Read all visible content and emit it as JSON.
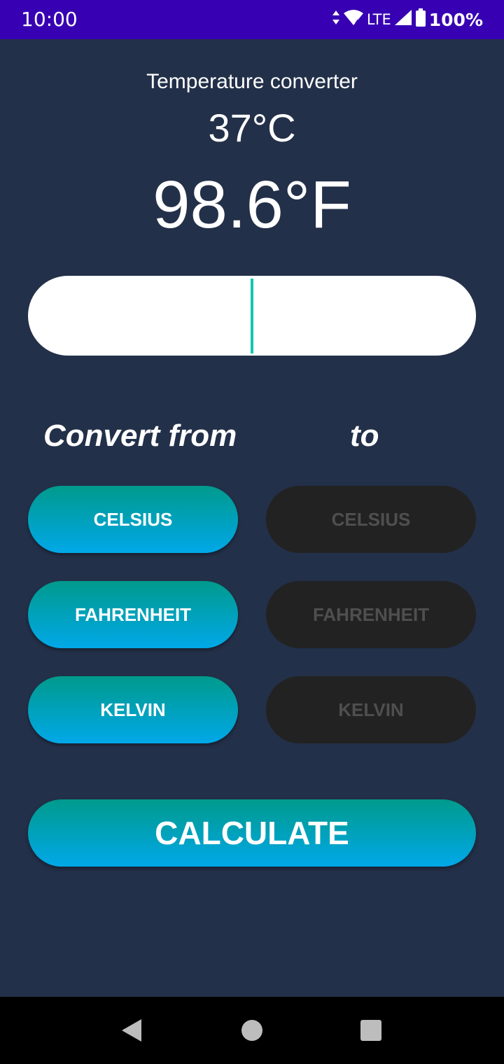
{
  "status_bar": {
    "time": "10:00",
    "network": "LTE",
    "battery": "100%"
  },
  "header": {
    "title": "Temperature converter",
    "from_value": "37°C",
    "result_value": "98.6°F"
  },
  "input": {
    "value": "",
    "placeholder": ""
  },
  "labels": {
    "convert_from": "Convert from",
    "to": "to"
  },
  "from_units": [
    {
      "label": "CELSIUS"
    },
    {
      "label": "FAHRENHEIT"
    },
    {
      "label": "KELVIN"
    }
  ],
  "to_units": [
    {
      "label": "CELSIUS"
    },
    {
      "label": "FAHRENHEIT"
    },
    {
      "label": "KELVIN"
    }
  ],
  "calculate_label": "CALCULATE",
  "colors": {
    "background": "#233049",
    "status_bar": "#3700b3",
    "accent_top": "#009a8c",
    "accent_bottom": "#00a8e8",
    "inactive_button": "#222222",
    "cursor": "#12c6b4"
  },
  "nav_icons": [
    "back-icon",
    "home-icon",
    "recents-icon"
  ]
}
